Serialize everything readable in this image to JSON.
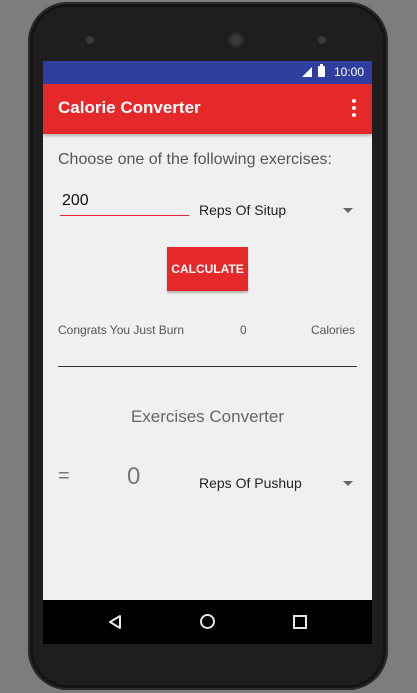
{
  "status_bar": {
    "time": "10:00",
    "icons": [
      "signal-icon",
      "battery-icon"
    ]
  },
  "app_bar": {
    "title": "Calorie Converter",
    "overflow_icon": "more-vert-icon"
  },
  "form": {
    "prompt": "Choose one of the following exercises:",
    "amount_value": "200",
    "exercise_spinner_selected": "Reps Of Situp",
    "calculate_label": "CALCULATE"
  },
  "result": {
    "prefix": "Congrats You Just Burn",
    "value": "0",
    "unit": "Calories"
  },
  "converter": {
    "title": "Exercises Converter",
    "equals": "=",
    "value": "0",
    "target_spinner_selected": "Reps Of Pushup"
  },
  "nav_bar": {
    "icons": [
      "back-icon",
      "home-icon",
      "recents-icon"
    ]
  },
  "colors": {
    "primary": "#e5292b",
    "status_bar": "#303f9f",
    "background": "#f0f0f0"
  }
}
